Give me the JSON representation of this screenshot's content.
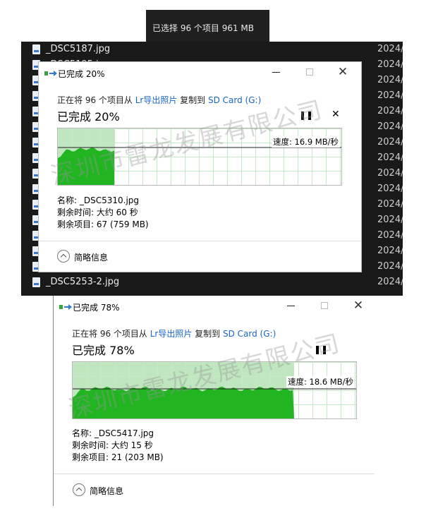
{
  "selection_bar": {
    "text": "已选择 96 个项目  961 MB"
  },
  "explorer": {
    "rows": [
      {
        "name": "_DSC5187.jpg",
        "date": "2024/"
      },
      {
        "name": "_DSC5195.jpg",
        "date": "2024/"
      },
      {
        "name": "",
        "date": "2024/"
      },
      {
        "name": "",
        "date": "2024/"
      },
      {
        "name": "",
        "date": "2024/"
      },
      {
        "name": "",
        "date": "2024/"
      },
      {
        "name": "",
        "date": "2024/"
      },
      {
        "name": "",
        "date": "2024/"
      },
      {
        "name": "",
        "date": "2024/"
      },
      {
        "name": "",
        "date": "2024/"
      },
      {
        "name": "",
        "date": "2024/"
      },
      {
        "name": "",
        "date": "2024/"
      },
      {
        "name": "",
        "date": "2024/"
      },
      {
        "name": "",
        "date": "2024/"
      },
      {
        "name": "",
        "date": "2024/"
      },
      {
        "name": "_DSC5253-2.jpg",
        "date": "2024/"
      }
    ]
  },
  "dialogs": [
    {
      "title": "已完成 20%",
      "copy_prefix": "正在将 96 个项目从 ",
      "source": "Lr导出照片",
      "copy_mid": " 复制到 ",
      "dest": "SD Card (G:)",
      "percent_label": "已完成 20%",
      "progress": 0.2,
      "speed": "速度: 16.9 MB/秒",
      "name_line": "名称: _DSC5310.jpg",
      "time_line": "剩余时间: 大约 60 秒",
      "items_line": "剩余项目: 67 (759 MB)",
      "collapse": "简略信息"
    },
    {
      "title": "已完成 78%",
      "copy_prefix": "正在将 96 个项目从 ",
      "source": "Lr导出照片",
      "copy_mid": " 复制到 ",
      "dest": "SD Card (G:)",
      "percent_label": "已完成 78%",
      "progress": 0.78,
      "speed": "速度: 18.6 MB/秒",
      "name_line": "名称: _DSC5417.jpg",
      "time_line": "剩余时间: 大约 15 秒",
      "items_line": "剩余项目: 21 (203 MB)",
      "collapse": "简略信息"
    }
  ],
  "watermark": "深圳市雷龙发展有限公司",
  "colors": {
    "graph_fill": "#21b521",
    "graph_done": "#bfe6bf",
    "link": "#1a64c8",
    "explorer_bg": "#191919"
  },
  "icons": {
    "copy": "copy-arrow-icon",
    "file": "file-image-icon",
    "pause": "pause-icon",
    "close": "close-icon",
    "collapse": "chevron-up-icon"
  }
}
